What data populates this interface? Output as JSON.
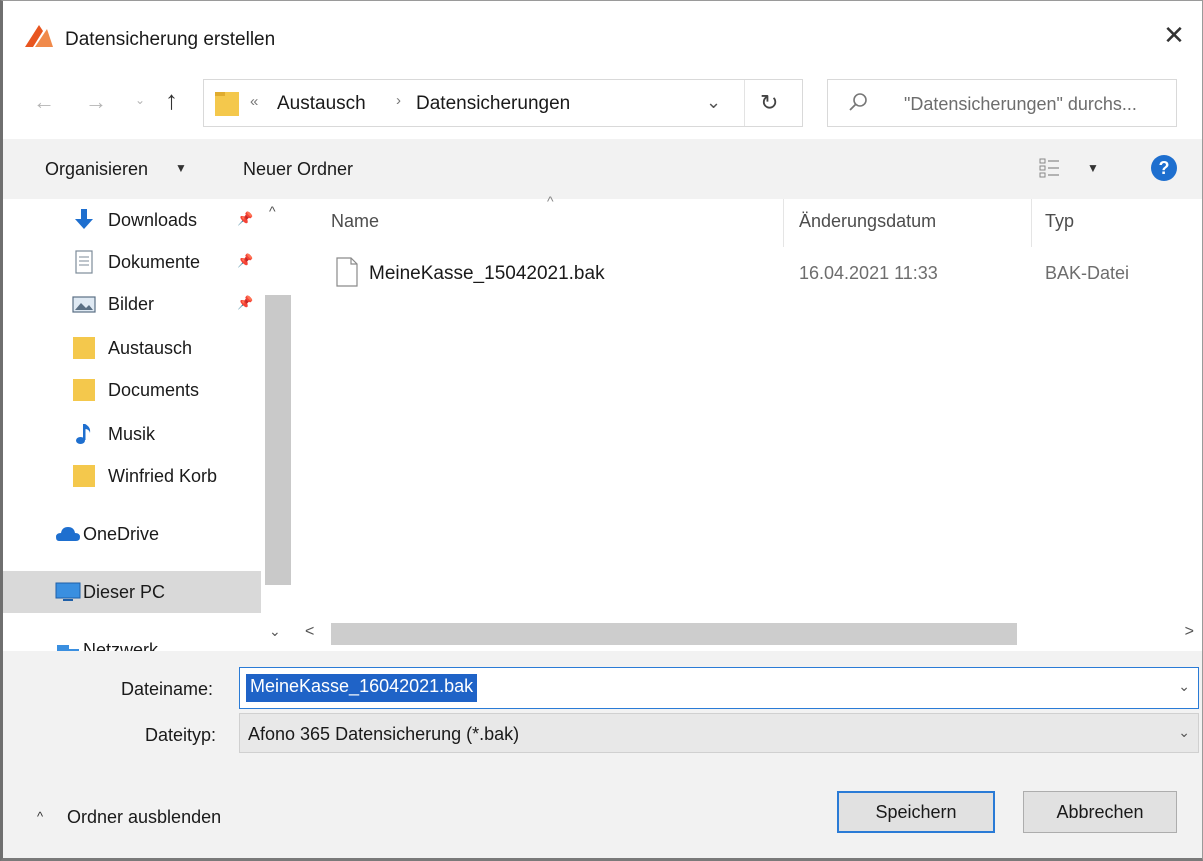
{
  "window": {
    "title": "Datensicherung erstellen",
    "close_glyph": "✕"
  },
  "nav": {
    "back_glyph": "←",
    "forward_glyph": "→",
    "recent_glyph": "⌄",
    "up_glyph": "↑",
    "address": {
      "overflow_glyph": "«",
      "segment1": "Austausch",
      "separator": "›",
      "segment2": "Datensicherungen",
      "dropdown_glyph": "⌄"
    },
    "refresh_glyph": "↻",
    "search_placeholder": "\"Datensicherungen\" durchs..."
  },
  "commands": {
    "organize": "Organisieren",
    "organize_caret": "▼",
    "new_folder": "Neuer Ordner",
    "view_caret": "▼",
    "help": "?"
  },
  "sidebar": {
    "items": [
      {
        "label": "Downloads",
        "icon": "download-arrow-icon",
        "pinned": true
      },
      {
        "label": "Dokumente",
        "icon": "document-icon",
        "pinned": true
      },
      {
        "label": "Bilder",
        "icon": "pictures-icon",
        "pinned": true
      },
      {
        "label": "Austausch",
        "icon": "folder-icon",
        "pinned": false
      },
      {
        "label": "Documents",
        "icon": "folder-icon",
        "pinned": false
      },
      {
        "label": "Musik",
        "icon": "music-note-icon",
        "pinned": false
      },
      {
        "label": "Winfried Korb",
        "icon": "folder-icon",
        "pinned": false
      },
      {
        "label": "OneDrive",
        "icon": "cloud-icon",
        "pinned": false
      },
      {
        "label": "Dieser PC",
        "icon": "computer-icon",
        "pinned": false,
        "selected": true
      },
      {
        "label": "Netzwerk",
        "icon": "network-icon",
        "pinned": false
      }
    ],
    "pin_glyph": "📌",
    "scroll_up_glyph": "^",
    "scroll_down_glyph": "⌄"
  },
  "filelist": {
    "sort_caret": "^",
    "columns": [
      "Name",
      "Änderungsdatum",
      "Typ"
    ],
    "rows": [
      {
        "name": "MeineKasse_15042021.bak",
        "date": "16.04.2021 11:33",
        "type": "BAK-Datei"
      }
    ],
    "hscroll_left": "<",
    "hscroll_right": ">"
  },
  "form": {
    "filename_label": "Dateiname:",
    "filename_value": "MeineKasse_16042021.bak",
    "filetype_label": "Dateityp:",
    "filetype_value": "Afono 365 Datensicherung (*.bak)",
    "dropdown_glyph": "⌄",
    "hide_folders_glyph": "^",
    "hide_folders_label": "Ordner ausblenden",
    "save_label": "Speichern",
    "cancel_label": "Abbrechen"
  },
  "colors": {
    "accent": "#1f63c7",
    "app_icon": "#e8551f",
    "folder": "#f4c84c",
    "selection_bg": "#d9d9d9",
    "panel_bg": "#f2f2f2"
  }
}
